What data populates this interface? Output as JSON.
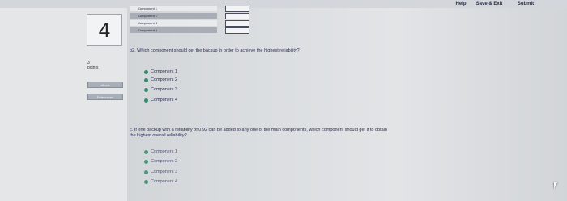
{
  "topbar": {
    "help_label": "Help",
    "save_exit_label": "Save & Exit",
    "submit_label": "Submit"
  },
  "sidebar": {
    "question_number": "4",
    "points_value": "3",
    "points_label": "points",
    "check_label": "eBook",
    "references_label": "References"
  },
  "component_table": {
    "rows": [
      {
        "label": "Component 1"
      },
      {
        "label": "Component 2"
      },
      {
        "label": "Component 3"
      },
      {
        "label": "Component 4"
      }
    ]
  },
  "question_b2": {
    "text": "b2. Which component should get the backup in order to achieve the highest reliability?",
    "options": [
      "Component 1",
      "Component 2",
      "Component 3",
      "Component 4"
    ]
  },
  "question_c": {
    "text_line1": "c. If one backup with a reliability of 0.92 can be added to any one of the main components, which component should get it to obtain",
    "text_line2": "the highest overall reliability?",
    "options": [
      "Component 1",
      "Component 2",
      "Component 3",
      "Component 4"
    ]
  },
  "colors": {
    "radio_selected": "#3a8b6a",
    "accent_text": "#2a2d55"
  }
}
